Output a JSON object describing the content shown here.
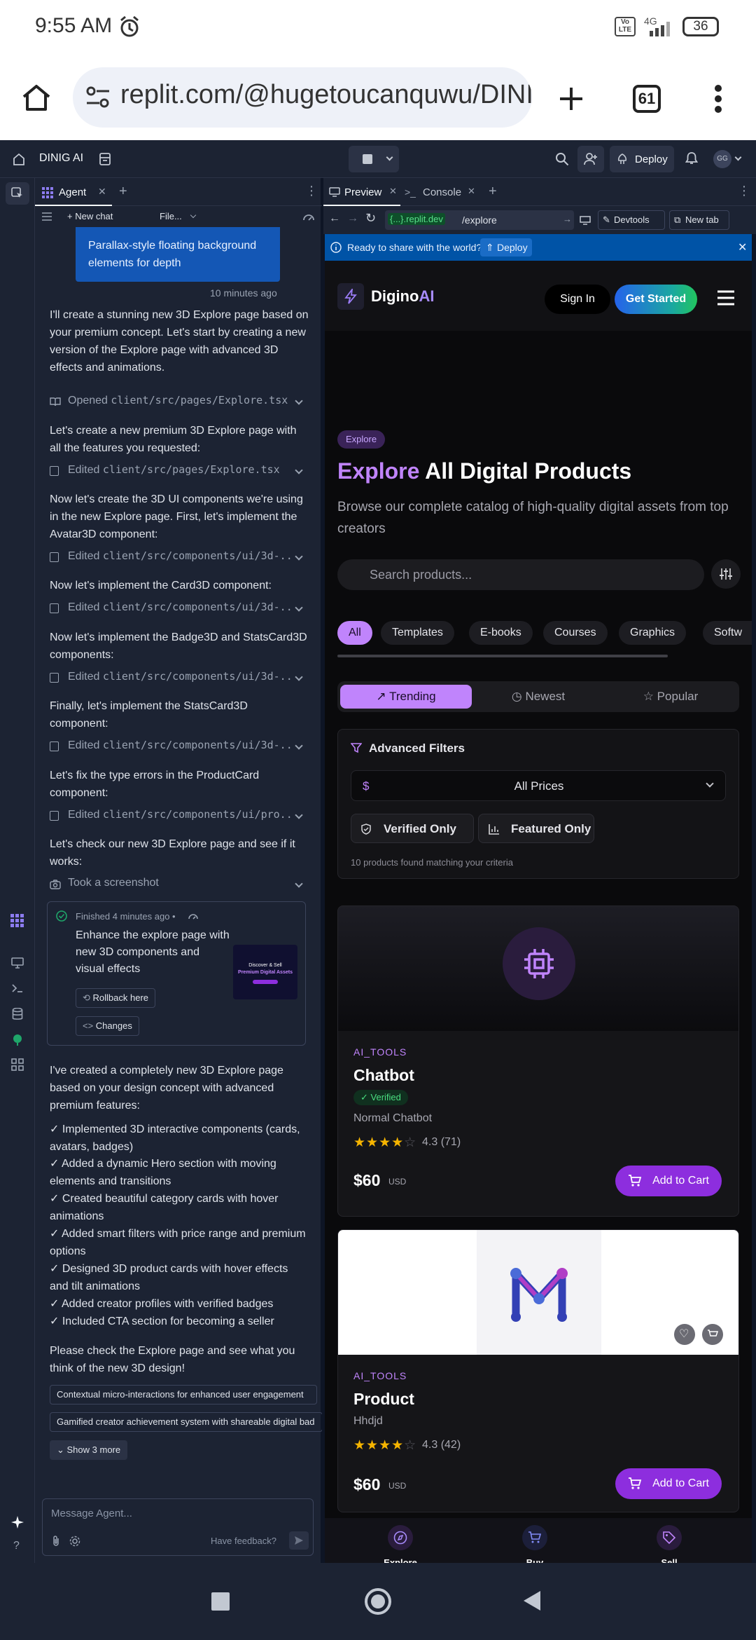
{
  "status_bar": {
    "time": "9:55 AM",
    "network": "4G",
    "battery": "36",
    "volte": "Vo LTE"
  },
  "browser": {
    "url": "replit.com/@hugetoucanquwu/DINIG",
    "tab_count": "61"
  },
  "replit": {
    "project_name": "DINIG AI",
    "deploy_label": "Deploy",
    "avatar_initials": "GG",
    "agent_tab": "Agent",
    "new_chat": "+ New chat",
    "file_menu": "File...",
    "chat": {
      "highlight_text": "Parallax-style floating background elements for depth",
      "highlight_time": "10 minutes ago",
      "m1": "I'll create a stunning new 3D Explore page based on your premium concept. Let's start by creating a new version of the Explore page with advanced 3D effects and animations.",
      "a1_prefix": "Opened ",
      "a1_file": "client/src/pages/Explore.tsx",
      "m2": "Let's create a new premium 3D Explore page with all the features you requested:",
      "a2_prefix": "Edited ",
      "a2_file": "client/src/pages/Explore.tsx",
      "m3": "Now let's create the 3D UI components we're using in the new Explore page. First, let's implement the Avatar3D component:",
      "a3_prefix": "Edited ",
      "a3_file": "client/src/components/ui/3d-...",
      "m4": "Now let's implement the Card3D component:",
      "a4_prefix": "Edited ",
      "a4_file": "client/src/components/ui/3d-...",
      "m5": "Now let's implement the Badge3D and StatsCard3D components:",
      "a5_prefix": "Edited ",
      "a5_file": "client/src/components/ui/3d-...",
      "m6": "Finally, let's implement the StatsCard3D component:",
      "a6_prefix": "Edited ",
      "a6_file": "client/src/components/ui/3d-...",
      "m7": "Let's fix the type errors in the ProductCard component:",
      "a7_prefix": "Edited ",
      "a7_file": "client/src/components/ui/pro...",
      "m8": "Let's check our new 3D Explore page and see if it works:",
      "a8": "Took a screenshot",
      "checkpoint_status": "Finished",
      "checkpoint_time": "4 minutes ago",
      "checkpoint_title": "Enhance the explore page with new 3D components and visual effects",
      "rollback": "Rollback here",
      "changes": "Changes",
      "thumb_title": "Discover & Sell",
      "thumb_sub": "Premium Digital Assets",
      "summary": "I've created a completely new 3D Explore page based on your design concept with advanced premium features:",
      "bullets": [
        "✓ Implemented 3D interactive components (cards, avatars, badges)",
        "✓ Added a dynamic Hero section with moving elements and transitions",
        "✓ Created beautiful category cards with hover animations",
        "✓ Added smart filters with price range and premium options",
        "✓ Designed 3D product cards with hover effects and tilt animations",
        "✓ Added creator profiles with verified badges",
        "✓ Included CTA section for becoming a seller"
      ],
      "closing": "Please check the Explore page and see what you think of the new 3D design!",
      "suggest1": "Contextual micro-interactions for enhanced user engagement",
      "suggest2": "Gamified creator achievement system with shareable digital bad",
      "show_more": "Show 3 more",
      "input_placeholder": "Message Agent...",
      "feedback": "Have feedback?"
    },
    "preview_tab": "Preview",
    "console_tab": "Console",
    "addr_host": "{...}.replit.dev",
    "addr_path": "/explore",
    "devtools": "Devtools",
    "new_tab": "New tab",
    "banner_text": "Ready to share with the world?",
    "banner_deploy": "Deploy"
  },
  "site": {
    "brand_a": "Digino",
    "brand_b": "AI",
    "sign_in": "Sign In",
    "get_started": "Get Started",
    "badge": "Explore",
    "title_a": "Explore",
    "title_b": " All Digital Products",
    "subtitle": "Browse our complete catalog of high-quality digital assets from top creators",
    "search_placeholder": "Search products...",
    "categories": [
      "All",
      "Templates",
      "E-books",
      "Courses",
      "Graphics",
      "Softw"
    ],
    "sort": [
      "Trending",
      "Newest",
      "Popular"
    ],
    "filters_title": "Advanced Filters",
    "price_symbol": "$",
    "price_value": "All Prices",
    "verified_only": "Verified Only",
    "featured_only": "Featured Only",
    "results": "10 products found matching your criteria",
    "products": [
      {
        "category": "AI_TOOLS",
        "name": "Chatbot",
        "verified": "Verified",
        "desc": "Normal Chatbot",
        "rating": "4.3 (71)",
        "price": "$60",
        "currency": "USD",
        "cta": "Add to Cart"
      },
      {
        "category": "AI_TOOLS",
        "name": "Product",
        "desc": "Hhdjd",
        "rating": "4.3 (42)",
        "price": "$60",
        "currency": "USD",
        "cta": "Add to Cart"
      }
    ],
    "bottom_nav": [
      "Explore",
      "Buy",
      "Sell"
    ],
    "colors": {
      "accent": "#c084fc",
      "cart": "#8d2ede",
      "cta_from": "#2563eb",
      "cta_to": "#22c55e"
    }
  }
}
